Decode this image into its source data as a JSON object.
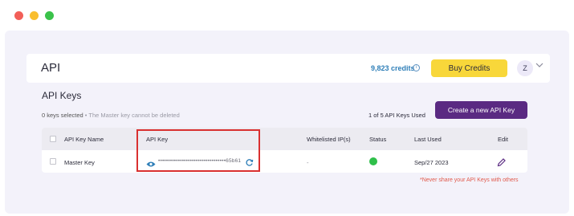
{
  "window": {
    "buttons": [
      "close",
      "minimize",
      "maximize"
    ]
  },
  "header": {
    "title": "API",
    "credits": "9,823 credits",
    "buy_label": "Buy Credits",
    "avatar_letter": "Z"
  },
  "keys": {
    "title": "API Keys",
    "selected": "0 keys selected",
    "master_note": " • The Master key cannot be deleted",
    "used": "1 of 5 API Keys Used",
    "create_label": "Create a new API Key"
  },
  "table": {
    "columns": [
      "API Key Name",
      "API Key",
      "Whitelisted IP(s)",
      "Status",
      "Last Used",
      "Edit"
    ],
    "rows": [
      {
        "name": "Master Key",
        "key_masked": "••••••••••••••••••••••••••••••••••65b61",
        "whitelisted": "-",
        "status": "active",
        "last_used": "Sep/27 2023"
      }
    ]
  },
  "warning": "*Never share your API Keys with others",
  "colors": {
    "accent_purple": "#5a2a82",
    "buy_yellow": "#f8d73a",
    "status_green": "#2fbf4a",
    "highlight_red": "#d93030"
  }
}
